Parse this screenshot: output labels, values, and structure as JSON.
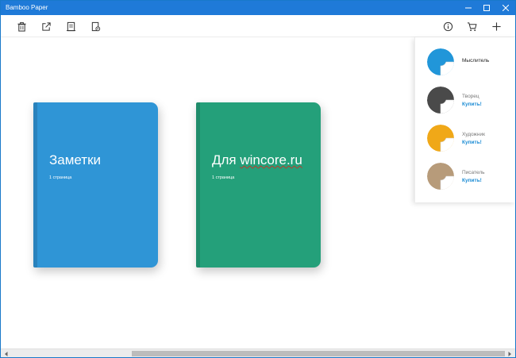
{
  "window": {
    "title": "Bamboo Paper"
  },
  "toolbar": {
    "left_icons": [
      "trash-icon",
      "share-icon",
      "pages-icon",
      "settings-icon"
    ],
    "right_icons": [
      "info-icon",
      "cart-icon",
      "plus-icon"
    ]
  },
  "notebooks": [
    {
      "title": "Заметки",
      "pages": "1 страница",
      "color": "#2f95d6"
    },
    {
      "title_prefix": "Для ",
      "title_word": "wincore.ru",
      "pages": "1 страница",
      "color": "#24a07a"
    }
  ],
  "covers": [
    {
      "name": "Мыслитель",
      "buy": "",
      "color": "#2196d9"
    },
    {
      "name": "Творец",
      "buy": "Купить!",
      "color": "#4a4a4a"
    },
    {
      "name": "Художник",
      "buy": "Купить!",
      "color": "#f0a818"
    },
    {
      "name": "Писатель",
      "buy": "Купить!",
      "color": "#b79b7a"
    }
  ],
  "colors": {
    "titlebar": "#1f7ad8",
    "accent": "#1a8bd4"
  }
}
